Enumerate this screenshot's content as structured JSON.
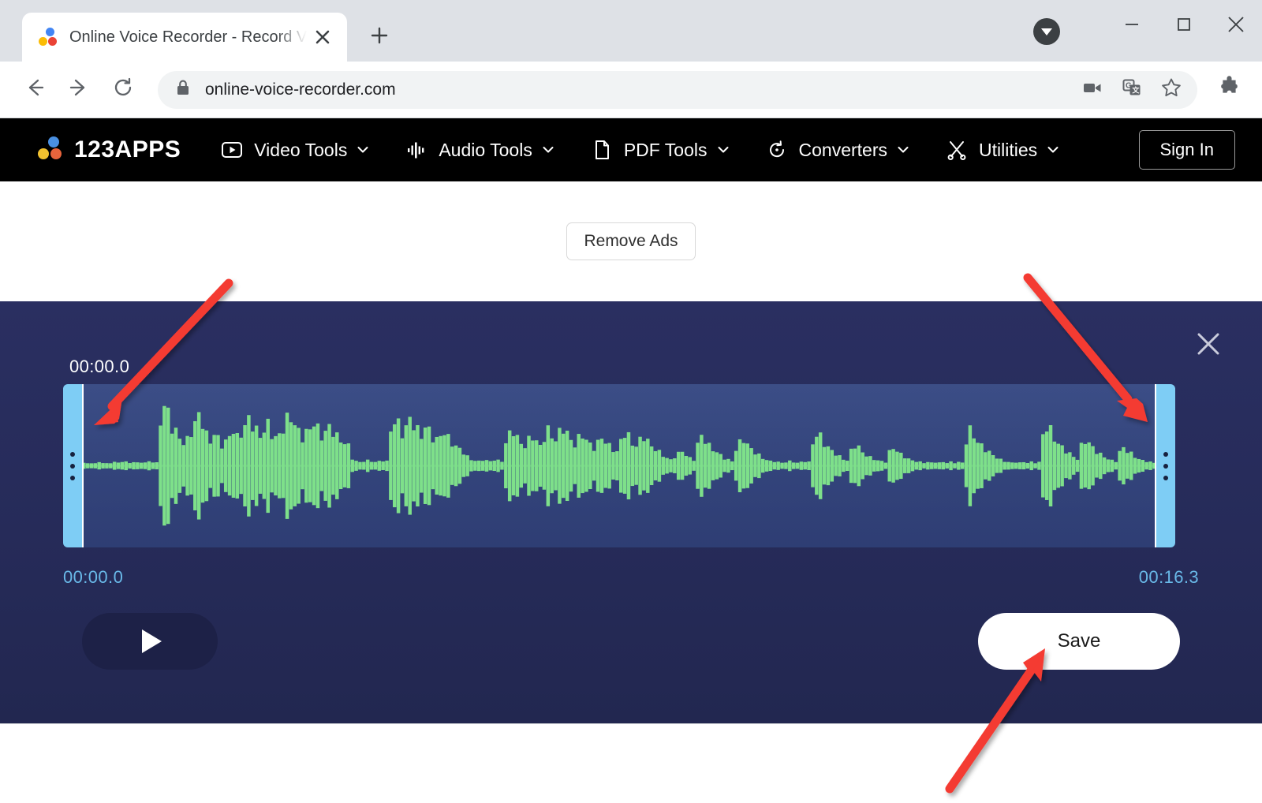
{
  "browser": {
    "tab": {
      "title": "Online Voice Recorder - Record V",
      "favicon_icon": "123apps-dots-icon",
      "close_icon": "close-icon"
    },
    "new_tab_icon": "plus-icon",
    "window_controls": {
      "download_indicator_icon": "download-arrow-icon",
      "minimize_icon": "minimize-icon",
      "maximize_icon": "maximize-icon",
      "close_icon": "window-close-icon"
    },
    "toolbar": {
      "back_icon": "back-arrow-icon",
      "forward_icon": "forward-arrow-icon",
      "reload_icon": "reload-icon",
      "lock_icon": "lock-icon",
      "url": "online-voice-recorder.com",
      "actions": [
        {
          "icon": "video-camera-icon"
        },
        {
          "icon": "google-translate-icon"
        },
        {
          "icon": "bookmark-star-icon"
        }
      ],
      "extensions_icon": "puzzle-piece-icon"
    }
  },
  "site_nav": {
    "logo_text": "123APPS",
    "logo_icon": "123apps-dots-icon",
    "items": [
      {
        "label": "Video Tools",
        "icon": "play-box-icon",
        "caret": "chevron-down-icon"
      },
      {
        "label": "Audio Tools",
        "icon": "audio-bars-icon",
        "caret": "chevron-down-icon"
      },
      {
        "label": "PDF Tools",
        "icon": "document-page-icon",
        "caret": "chevron-down-icon"
      },
      {
        "label": "Converters",
        "icon": "convert-refresh-icon",
        "caret": "chevron-down-icon"
      },
      {
        "label": "Utilities",
        "icon": "scissors-icon",
        "caret": "chevron-down-icon"
      }
    ],
    "sign_in_label": "Sign In"
  },
  "ads": {
    "remove_ads_label": "Remove Ads"
  },
  "recorder": {
    "close_icon": "close-icon",
    "cursor_time": "00:00.0",
    "selection_start": "00:00.0",
    "selection_end": "00:16.3",
    "play_label": "",
    "play_icon": "play-triangle-icon",
    "save_label": "Save",
    "handle_left_icon": "drag-handle-dots-icon",
    "handle_right_icon": "drag-handle-dots-icon",
    "colors": {
      "panel_bg": "#262b59",
      "waveform": "#7ee08a",
      "handle": "#7ecdf5",
      "time_label": "#69b9e8",
      "save_bg": "#ffffff"
    },
    "waveform_peaks": [
      0.04,
      0.03,
      0.04,
      0.03,
      0.05,
      0.04,
      0.03,
      0.04,
      0.05,
      0.04,
      0.06,
      0.05,
      0.04,
      0.05,
      0.04,
      0.05,
      0.04,
      0.06,
      0.05,
      0.04,
      0.62,
      0.78,
      0.7,
      0.52,
      0.44,
      0.38,
      0.3,
      0.34,
      0.46,
      0.55,
      0.68,
      0.58,
      0.4,
      0.33,
      0.42,
      0.36,
      0.28,
      0.31,
      0.4,
      0.48,
      0.37,
      0.44,
      0.52,
      0.62,
      0.55,
      0.46,
      0.4,
      0.47,
      0.54,
      0.43,
      0.36,
      0.42,
      0.5,
      0.6,
      0.66,
      0.54,
      0.45,
      0.38,
      0.43,
      0.5,
      0.58,
      0.48,
      0.4,
      0.44,
      0.52,
      0.46,
      0.38,
      0.34,
      0.3,
      0.26,
      0.1,
      0.06,
      0.05,
      0.06,
      0.07,
      0.06,
      0.05,
      0.06,
      0.07,
      0.06,
      0.48,
      0.6,
      0.54,
      0.44,
      0.5,
      0.62,
      0.56,
      0.46,
      0.4,
      0.52,
      0.46,
      0.38,
      0.34,
      0.4,
      0.46,
      0.36,
      0.3,
      0.26,
      0.22,
      0.18,
      0.12,
      0.08,
      0.07,
      0.06,
      0.08,
      0.07,
      0.06,
      0.08,
      0.07,
      0.06,
      0.3,
      0.42,
      0.48,
      0.36,
      0.3,
      0.26,
      0.34,
      0.4,
      0.32,
      0.26,
      0.38,
      0.46,
      0.4,
      0.34,
      0.44,
      0.52,
      0.42,
      0.34,
      0.28,
      0.36,
      0.42,
      0.34,
      0.28,
      0.24,
      0.3,
      0.38,
      0.32,
      0.26,
      0.22,
      0.18,
      0.34,
      0.44,
      0.38,
      0.3,
      0.26,
      0.34,
      0.4,
      0.32,
      0.26,
      0.22,
      0.18,
      0.14,
      0.1,
      0.08,
      0.12,
      0.16,
      0.2,
      0.14,
      0.1,
      0.08,
      0.28,
      0.4,
      0.34,
      0.26,
      0.22,
      0.18,
      0.14,
      0.1,
      0.08,
      0.06,
      0.22,
      0.3,
      0.36,
      0.28,
      0.22,
      0.18,
      0.14,
      0.1,
      0.08,
      0.06,
      0.06,
      0.05,
      0.04,
      0.05,
      0.06,
      0.05,
      0.04,
      0.05,
      0.06,
      0.05,
      0.3,
      0.42,
      0.38,
      0.3,
      0.24,
      0.2,
      0.16,
      0.12,
      0.09,
      0.07,
      0.2,
      0.28,
      0.24,
      0.18,
      0.14,
      0.11,
      0.09,
      0.07,
      0.06,
      0.05,
      0.18,
      0.24,
      0.2,
      0.15,
      0.12,
      0.09,
      0.07,
      0.06,
      0.05,
      0.04,
      0.05,
      0.04,
      0.05,
      0.04,
      0.05,
      0.04,
      0.05,
      0.04,
      0.05,
      0.04,
      0.34,
      0.46,
      0.4,
      0.32,
      0.26,
      0.22,
      0.18,
      0.14,
      0.11,
      0.08,
      0.06,
      0.05,
      0.04,
      0.05,
      0.04,
      0.05,
      0.04,
      0.05,
      0.04,
      0.05,
      0.4,
      0.54,
      0.46,
      0.36,
      0.3,
      0.24,
      0.2,
      0.16,
      0.12,
      0.09,
      0.26,
      0.34,
      0.3,
      0.24,
      0.19,
      0.15,
      0.12,
      0.09,
      0.07,
      0.06,
      0.18,
      0.24,
      0.2,
      0.16,
      0.12,
      0.09,
      0.07,
      0.06,
      0.05,
      0.04
    ]
  },
  "annotations": {
    "arrow_color": "#f43a32",
    "arrows": [
      {
        "name": "arrow-to-left-handle",
        "points_to": "left trim handle"
      },
      {
        "name": "arrow-to-right-handle",
        "points_to": "right trim handle"
      },
      {
        "name": "arrow-to-save-button",
        "points_to": "Save button"
      }
    ]
  }
}
